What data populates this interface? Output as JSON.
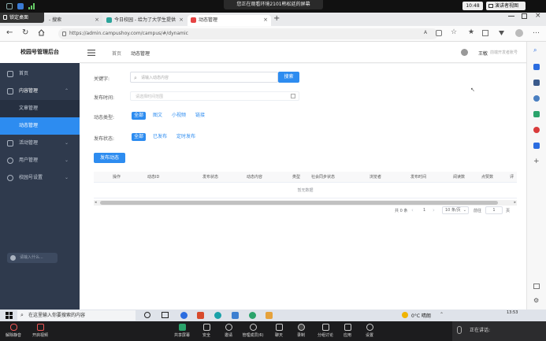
{
  "top_bar": {
    "share_banner": "您正在观看环境2101韩松廷的屏幕",
    "clock": "10:48",
    "presenter_view": "演讲者视图"
  },
  "browser": {
    "lock_tip": "锁定桌面",
    "tabs": [
      {
        "label": "- 搜索",
        "color": "#2b6de0"
      },
      {
        "label": "今日校园 - 给为了大学生提供",
        "color": "#2aa39a"
      },
      {
        "label": "动态管理",
        "color": "#e64444"
      }
    ],
    "new_tab": "+",
    "url": "https://admin.campushoy.com/campus/#/dynamic"
  },
  "app": {
    "brand": "校园号管理后台",
    "breadcrumb": [
      "首页",
      "动态管理"
    ],
    "user_name": "王敏",
    "user_extra": "前端开发者账号",
    "sidebar": {
      "items": [
        {
          "label": "首页",
          "chevron": ""
        },
        {
          "label": "内容管理",
          "chevron": "⌃"
        },
        {
          "label": "文章管理",
          "chevron": ""
        },
        {
          "label": "动态管理",
          "chevron": ""
        },
        {
          "label": "活动管理",
          "chevron": "⌄"
        },
        {
          "label": "用户管理",
          "chevron": "⌄"
        },
        {
          "label": "校园号设置",
          "chevron": "⌄"
        }
      ],
      "search_placeholder": "请输入什么..."
    },
    "filters": {
      "keyword_label": "关键字:",
      "keyword_placeholder": "请输入动态内容",
      "search_button": "搜索",
      "time_label": "发布时间:",
      "time_placeholder": "请选择时间范围",
      "type_label": "动态类型:",
      "type_options": [
        "全部",
        "图文",
        "小视频",
        "链接"
      ],
      "status_label": "发布状态:",
      "status_options": [
        "全部",
        "已发布",
        "定时发布"
      ]
    },
    "publish_button": "发布动态",
    "table": {
      "columns": [
        "操作",
        "动态ID",
        "发布状态",
        "动态内容",
        "类型",
        "社会同步状态",
        "浏览者",
        "发布时间",
        "阅读数",
        "点赞数",
        "评"
      ],
      "empty_text": "暂无数据"
    },
    "pagination": {
      "total": "共 0 条",
      "prev": "‹",
      "page": "1",
      "next": "›",
      "page_size": "10 条/页",
      "goto_label": "前往",
      "goto_value": "1",
      "unit": "页"
    }
  },
  "taskbar": {
    "search_placeholder": "在这里输入你要搜索的内容",
    "weather": "0°C 晴朗",
    "time": "13:53"
  },
  "meeting": {
    "left_tools": [
      {
        "label": "解除静音"
      },
      {
        "label": "开启视频"
      }
    ],
    "tools": [
      {
        "label": "共享屏幕"
      },
      {
        "label": "安全"
      },
      {
        "label": "邀请"
      },
      {
        "label": "管理成员(6)"
      },
      {
        "label": "聊天"
      },
      {
        "label": "录制"
      },
      {
        "label": "分组讨论"
      },
      {
        "label": "应用"
      },
      {
        "label": "设置"
      }
    ],
    "speaking": "正在讲话:"
  }
}
